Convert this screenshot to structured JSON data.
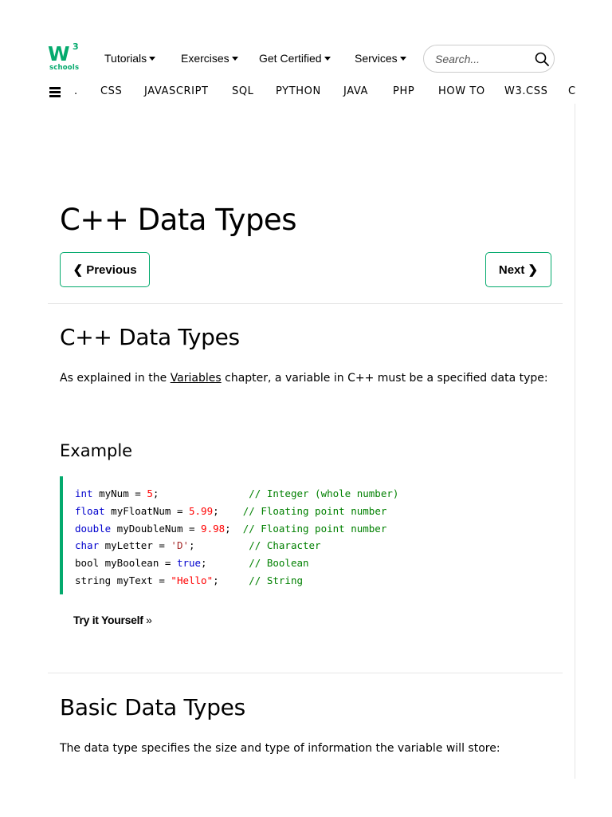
{
  "logo": {
    "main": "W",
    "superscript": "3",
    "sub": "schools",
    "color": "#04aa6d"
  },
  "topnav": [
    {
      "label": "Tutorials"
    },
    {
      "label": "Exercises"
    },
    {
      "label": "Get Certified"
    },
    {
      "label": "Services"
    }
  ],
  "search": {
    "placeholder": "Search...",
    "value": ""
  },
  "subnav": [
    ".",
    "CSS",
    "JAVASCRIPT",
    "SQL",
    "PYTHON",
    "JAVA",
    "PHP",
    "HOW TO",
    "W3.CSS",
    "C"
  ],
  "page": {
    "title": "C++ Data Types",
    "prev_label": "Previous",
    "next_label": "Next"
  },
  "section1": {
    "heading": "C++ Data Types",
    "intro_before": "As explained in the ",
    "intro_link": "Variables",
    "intro_after": " chapter, a variable in C++ must be a specified data type:"
  },
  "example": {
    "heading": "Example",
    "try_label": "Try it Yourself",
    "try_suffix": "»"
  },
  "section2": {
    "heading": "Basic Data Types",
    "intro": "The data type specifies the size and type of information the variable will store:"
  },
  "colors": {
    "accent": "#04aa6d",
    "keyword": "#0000cd",
    "number": "#ff0000",
    "comment": "#008000"
  }
}
